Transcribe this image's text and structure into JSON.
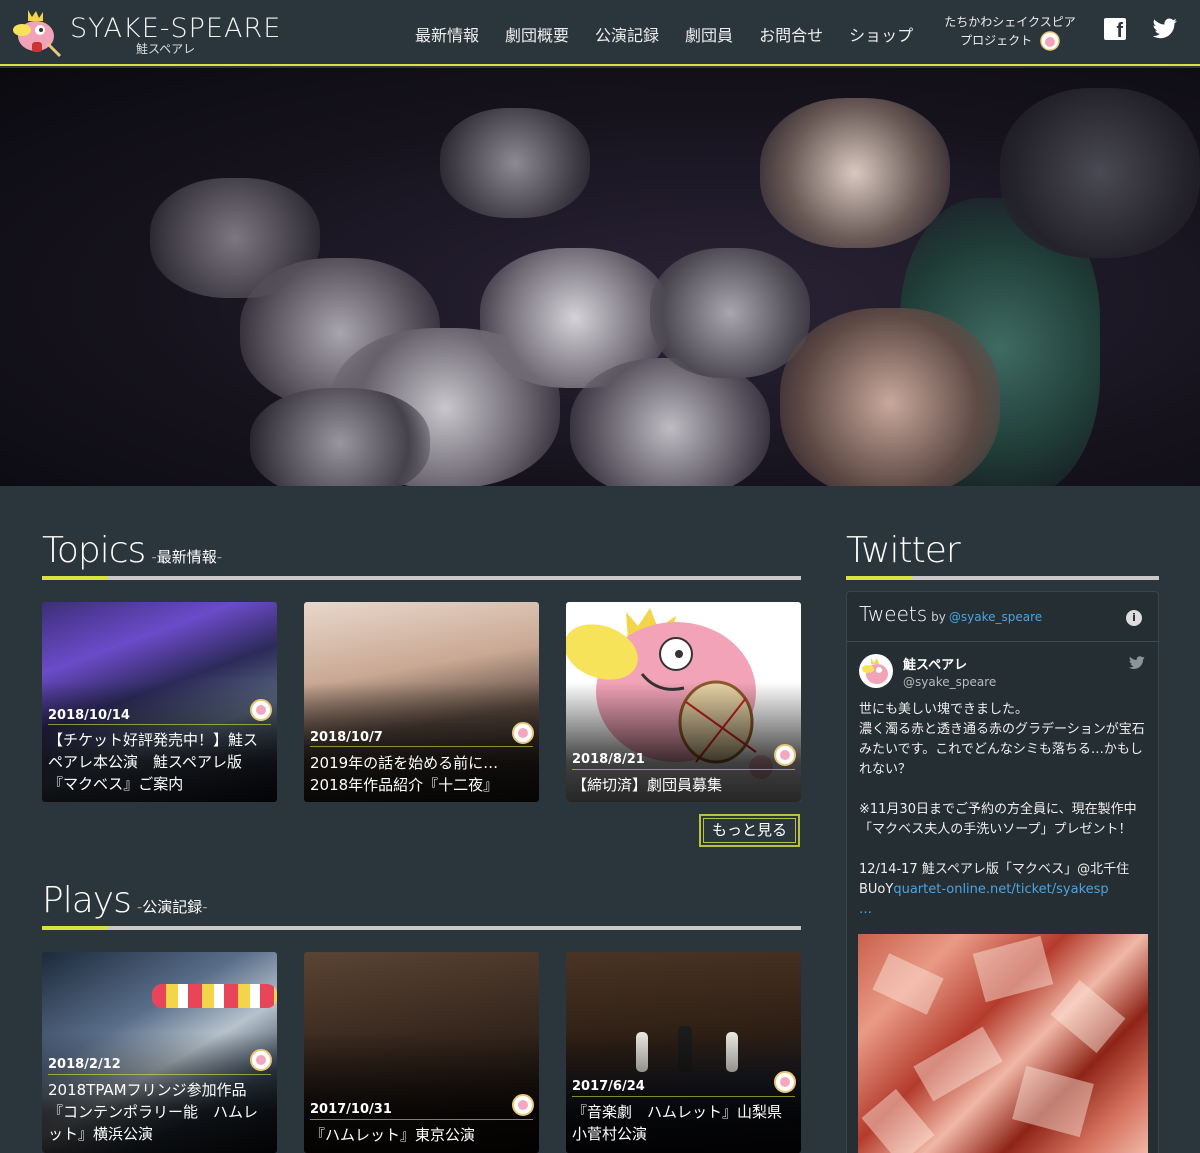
{
  "header": {
    "logo_title": "SYAKE-SPEARE",
    "logo_sub": "鮭スペアレ",
    "nav": [
      "最新情報",
      "劇団概要",
      "公演記録",
      "劇団員",
      "お問合せ",
      "ショップ"
    ],
    "project_line1": "たちかわシェイクスピア",
    "project_line2": "プロジェクト"
  },
  "topics": {
    "title": "Topics",
    "subtitle": "-最新情報-",
    "more": "もっと見る",
    "cards": [
      {
        "date": "2018/10/14",
        "title": "【チケット好評発売中！】鮭スペアレ本公演　鮭スペアレ版『マクベス』ご案内"
      },
      {
        "date": "2018/10/7",
        "title": "2019年の話を始める前に… 2018年作品紹介『十二夜』"
      },
      {
        "date": "2018/8/21",
        "title": "【締切済】劇団員募集"
      }
    ]
  },
  "plays": {
    "title": "Plays",
    "subtitle": "-公演記録-",
    "cards": [
      {
        "date": "2018/2/12",
        "title": "2018TPAMフリンジ参加作品『コンテンポラリー能　ハムレット』横浜公演"
      },
      {
        "date": "2017/10/31",
        "title": "『ハムレット』東京公演"
      },
      {
        "date": "2017/6/24",
        "title": "『音楽劇　ハムレット』山梨県小菅村公演"
      }
    ]
  },
  "twitter": {
    "title": "Twitter",
    "widget_title": "Tweets",
    "by": "by",
    "handle": "@syake_speare",
    "tweet": {
      "name": "鮭スペアレ",
      "user": "@syake_speare",
      "line1": "世にも美しい塊できました。",
      "line2": "濃く濁る赤と透き通る赤のグラデーションが宝石みたいです。これでどんなシミも落ちる…かもしれない？",
      "line3": "※11月30日までご予約の方全員に、現在製作中「マクベス夫人の手洗いソープ」プレゼント！",
      "line4": "12/14-17 鮭スペアレ版「マクベス」@北千住BUoY",
      "link": "quartet-online.net/ticket/syakesp",
      "ellipsis": "…"
    }
  },
  "colors": {
    "background": "#2b363c",
    "accent": "#d8e33b",
    "link": "#4da3e0"
  },
  "icons": [
    "salmon-logo-icon",
    "facebook-icon",
    "twitter-icon",
    "info-icon",
    "twitter-bird-icon"
  ]
}
